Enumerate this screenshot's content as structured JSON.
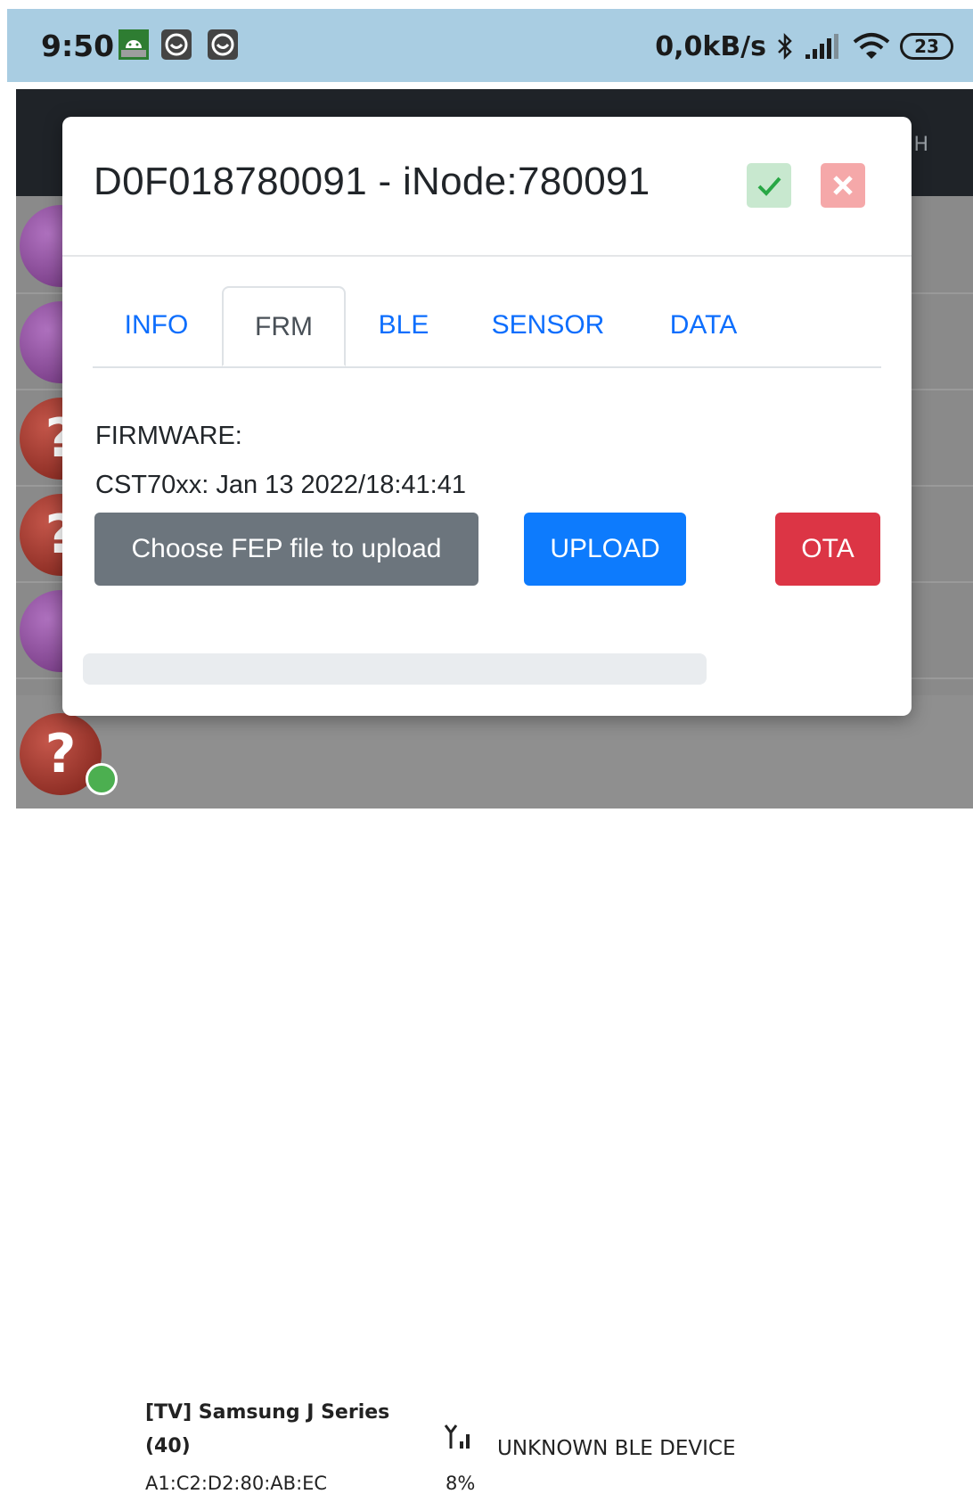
{
  "status_bar": {
    "time": "9:50",
    "network_speed": "0,0kB/s",
    "battery": "23"
  },
  "background_app": {
    "toolbar_partial_text": "H",
    "bottom_device": {
      "name_line1": "[TV] Samsung J Series",
      "name_line2": "(40)",
      "mac": "A1:C2:D2:80:AB:EC",
      "signal_percent": "8%",
      "type": "UNKNOWN BLE DEVICE"
    }
  },
  "modal": {
    "title": "D0F018780091 - iNode:780091",
    "tabs": [
      {
        "label": "INFO",
        "active": false
      },
      {
        "label": "FRM",
        "active": true
      },
      {
        "label": "BLE",
        "active": false
      },
      {
        "label": "SENSOR",
        "active": false
      },
      {
        "label": "DATA",
        "active": false
      }
    ],
    "firmware_label": "FIRMWARE:",
    "firmware_version": "CST70xx: Jan 13 2022/18:41:41",
    "choose_file_label": "Choose FEP file to upload",
    "upload_label": "UPLOAD",
    "ota_label": "OTA",
    "progress": 0
  },
  "colors": {
    "primary": "#0d7bfd",
    "secondary": "#6c757d",
    "danger": "#dc3545",
    "status_bar": "#a9cde2"
  }
}
